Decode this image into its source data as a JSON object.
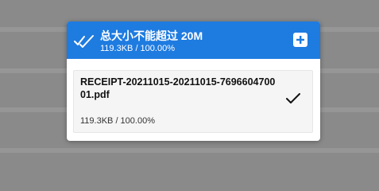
{
  "panel": {
    "header": {
      "title": "总大小不能超过 20M",
      "status": "119.3KB / 100.00%",
      "icon": "double-check-icon",
      "add_icon": "plus-icon"
    },
    "files": [
      {
        "name": "RECEIPT-20211015-20211015-769660470001.pdf",
        "status": "119.3KB / 100.00%",
        "progress_percent": 100,
        "icon": "check-icon"
      }
    ]
  },
  "colors": {
    "header_bg": "#1e7be0",
    "item_bg": "#f5f5f5",
    "backdrop": "#8a8a8a"
  }
}
